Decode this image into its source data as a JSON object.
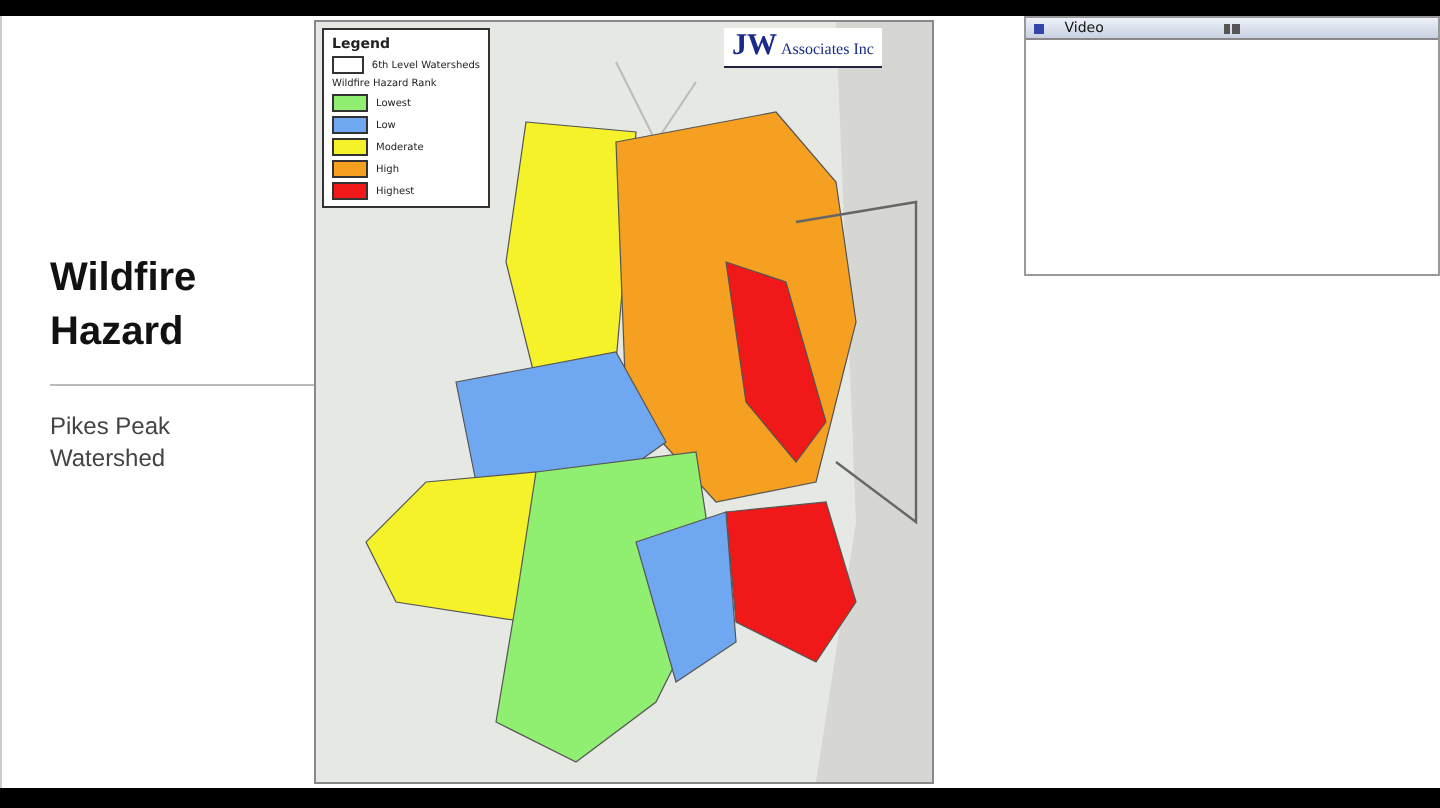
{
  "slide": {
    "title": "Wildfire Hazard",
    "subtitle": "Pikes Peak Watershed"
  },
  "map": {
    "legend": {
      "title": "Legend",
      "boundary_label": "6th Level Watersheds",
      "rank_title": "Wildfire Hazard Rank",
      "ranks": [
        {
          "label": "Lowest",
          "color": "#90ee70"
        },
        {
          "label": "Low",
          "color": "#6fa8f0"
        },
        {
          "label": "Moderate",
          "color": "#f5f22a"
        },
        {
          "label": "High",
          "color": "#f5a020"
        },
        {
          "label": "Highest",
          "color": "#f01818"
        }
      ]
    },
    "logo": {
      "mark": "JW",
      "name": "Associates Inc"
    }
  },
  "video_panel": {
    "title": "Video"
  }
}
